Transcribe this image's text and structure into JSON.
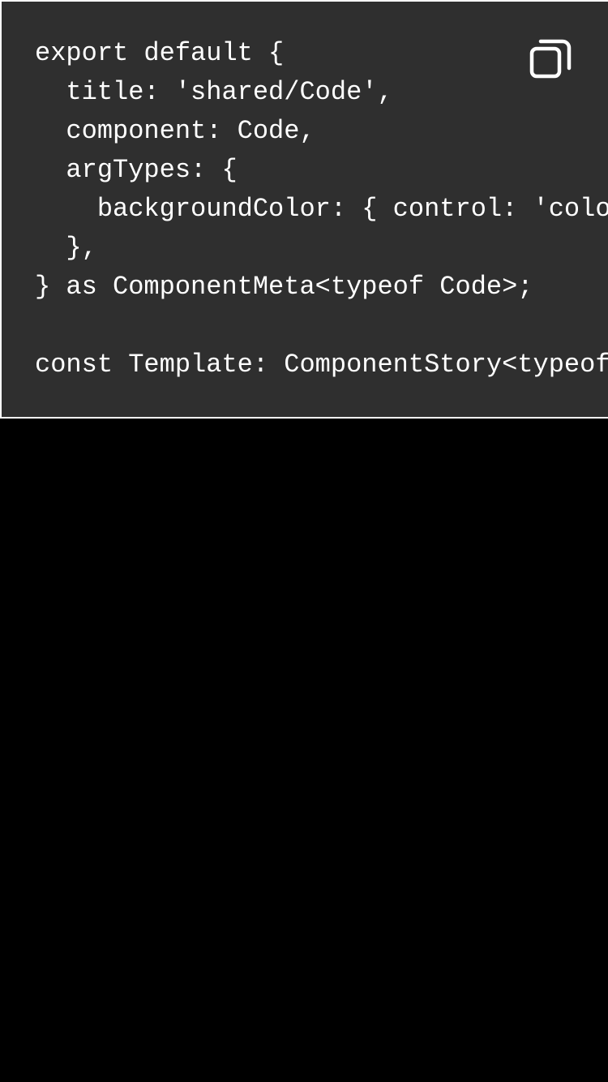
{
  "code": {
    "lines": [
      "export default {",
      "  title: 'shared/Code',",
      "  component: Code,",
      "  argTypes: {",
      "    backgroundColor: { control: 'colo",
      "  },",
      "} as ComponentMeta<typeof Code>;",
      "",
      "const Template: ComponentStory<typeof"
    ]
  },
  "copy_button": {
    "icon": "copy-icon"
  },
  "colors": {
    "code_bg": "#2f2f2f",
    "text": "#ffffff",
    "page_bg": "#000000"
  }
}
